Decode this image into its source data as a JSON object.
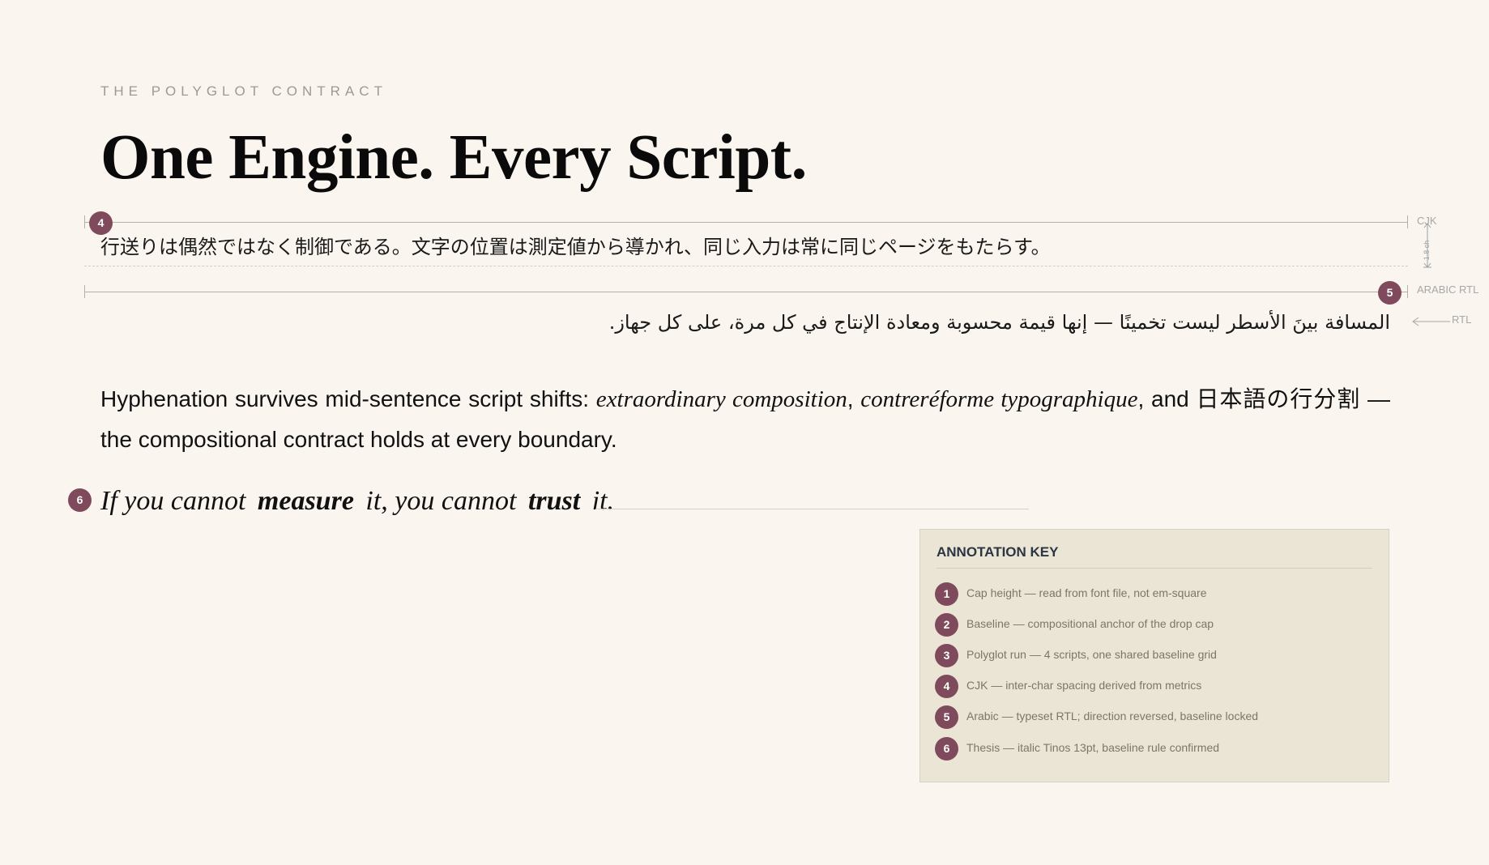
{
  "header": {
    "eyebrow": "THE POLYGLOT CONTRACT",
    "title": "One Engine. Every Script."
  },
  "cjk": {
    "badge": "4",
    "text": "行送りは偶然ではなく制御である。文字の位置は測定値から導かれ、同じ入力は常に同じページをもたらす。",
    "margin_label": "CJK",
    "dimension_label": "1.8 ch"
  },
  "arabic": {
    "badge": "5",
    "text": "المسافة بينَ الأسطر ليست تخمينًا — إنها قيمة محسوبة ومعادة الإنتاج في كل مرة، على كل جهاز.",
    "margin_label": "ARABIC RTL",
    "direction_label": "RTL"
  },
  "paragraph": {
    "lead": "Hyphenation survives mid-sentence script shifts: ",
    "italic_1": "extraordinary composition",
    "sep_1": ", ",
    "italic_2": "contreréforme typographique",
    "mid": ", and 日本語の行分割 — the compositional contract holds at every boundary."
  },
  "thesis": {
    "badge": "6",
    "part_1": "If you cannot ",
    "bold_1": "measure",
    "part_2": " it, you cannot ",
    "bold_2": "trust",
    "part_3": " it."
  },
  "annotation_key": {
    "title": "ANNOTATION KEY",
    "items": [
      {
        "num": "1",
        "text": "Cap height — read from font file, not em-square"
      },
      {
        "num": "2",
        "text": "Baseline — compositional anchor of the drop cap"
      },
      {
        "num": "3",
        "text": "Polyglot run — 4 scripts, one shared baseline grid"
      },
      {
        "num": "4",
        "text": "CJK — inter-char spacing derived from metrics"
      },
      {
        "num": "5",
        "text": "Arabic — typeset RTL; direction reversed, baseline locked"
      },
      {
        "num": "6",
        "text": "Thesis — italic Tinos 13pt, baseline rule confirmed"
      }
    ]
  },
  "colors": {
    "background": "#faf5ef",
    "badge": "#7e4a5c",
    "key_panel": "#ebe5d5",
    "muted_text": "#9a9a9a"
  }
}
